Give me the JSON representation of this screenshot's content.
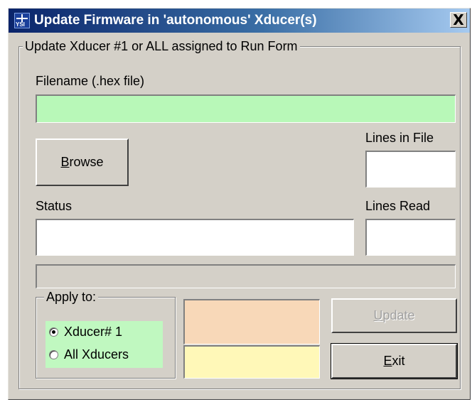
{
  "window": {
    "title": "Update Firmware in 'autonomous' Xducer(s)",
    "close_glyph": "X",
    "app_icon": "ysi-logo-icon",
    "app_icon_text": "YSI"
  },
  "group_main": {
    "legend": "Update Xducer #1 or ALL assigned to Run Form"
  },
  "filename": {
    "label": "Filename (.hex file)",
    "value": "",
    "color": "#b8f8b8"
  },
  "browse_button": {
    "hotkey": "B",
    "rest": "rowse"
  },
  "lines_in_file": {
    "label": "Lines in File",
    "value": ""
  },
  "status": {
    "label": "Status",
    "value": ""
  },
  "lines_read": {
    "label": "Lines Read",
    "value": ""
  },
  "progress": {
    "fraction": 0
  },
  "apply_to": {
    "legend": "Apply to:",
    "options": [
      {
        "label": "Xducer# 1",
        "checked": true
      },
      {
        "label": "All Xducers",
        "checked": false
      }
    ],
    "highlight_color": "#c0f8c0"
  },
  "indicators": {
    "top_color": "#f8d8b8",
    "bottom_color": "#fff8b8"
  },
  "update_button": {
    "hotkey": "U",
    "rest": "pdate",
    "enabled": false
  },
  "exit_button": {
    "hotkey": "E",
    "rest": "xit"
  }
}
